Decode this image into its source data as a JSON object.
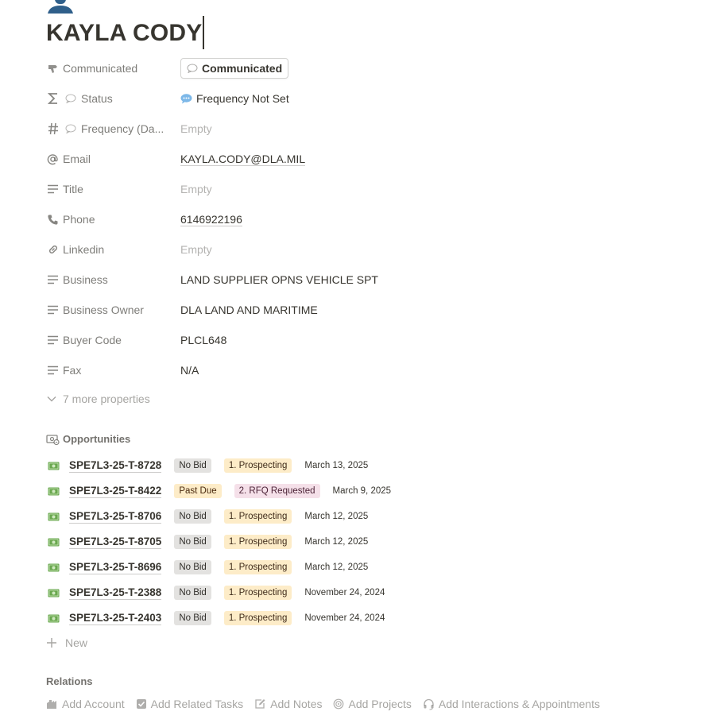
{
  "page": {
    "title": "KAYLA CODY"
  },
  "properties": [
    {
      "label": "Communicated",
      "value": "Communicated",
      "icon": "hand-pointer-icon",
      "type": "button"
    },
    {
      "label": "Status",
      "value": "Frequency Not Set",
      "icon": "formula-sigma-icon",
      "type": "status"
    },
    {
      "label": "Frequency (Da...",
      "value": "Empty",
      "icon": "number-hash-icon",
      "type": "empty"
    },
    {
      "label": "Email",
      "value": "KAYLA.CODY@DLA.MIL",
      "icon": "at-sign-icon",
      "type": "link"
    },
    {
      "label": "Title",
      "value": "Empty",
      "icon": "text-lines-icon",
      "type": "empty"
    },
    {
      "label": "Phone",
      "value": "6146922196",
      "icon": "phone-icon",
      "type": "link"
    },
    {
      "label": "Linkedin",
      "value": "Empty",
      "icon": "link-chain-icon",
      "type": "empty"
    },
    {
      "label": "Business",
      "value": "LAND SUPPLIER OPNS VEHICLE SPT",
      "icon": "text-lines-icon",
      "type": "text"
    },
    {
      "label": "Business Owner",
      "value": "DLA LAND AND MARITIME",
      "icon": "text-lines-icon",
      "type": "text"
    },
    {
      "label": "Buyer Code",
      "value": "PLCL648",
      "icon": "text-lines-icon",
      "type": "text"
    },
    {
      "label": "Fax",
      "value": "N/A",
      "icon": "text-lines-icon",
      "type": "text"
    }
  ],
  "more_properties": "7 more properties",
  "opportunities": {
    "heading": "Opportunities",
    "rows": [
      {
        "name": "SPE7L3-25-T-8728",
        "bid": "No Bid",
        "stage": "1. Prospecting",
        "date": "March 13, 2025"
      },
      {
        "name": "SPE7L3-25-T-8422",
        "bid": "Past Due",
        "stage": "2. RFQ Requested",
        "date": "March 9, 2025"
      },
      {
        "name": "SPE7L3-25-T-8706",
        "bid": "No Bid",
        "stage": "1. Prospecting",
        "date": "March 12, 2025"
      },
      {
        "name": "SPE7L3-25-T-8705",
        "bid": "No Bid",
        "stage": "1. Prospecting",
        "date": "March 12, 2025"
      },
      {
        "name": "SPE7L3-25-T-8696",
        "bid": "No Bid",
        "stage": "1. Prospecting",
        "date": "March 12, 2025"
      },
      {
        "name": "SPE7L3-25-T-2388",
        "bid": "No Bid",
        "stage": "1. Prospecting",
        "date": "November 24, 2024"
      },
      {
        "name": "SPE7L3-25-T-2403",
        "bid": "No Bid",
        "stage": "1. Prospecting",
        "date": "November 24, 2024"
      }
    ],
    "new_label": "New"
  },
  "relations": {
    "heading": "Relations",
    "items": [
      {
        "label": "Add Account",
        "icon": "building-icon"
      },
      {
        "label": "Add Related Tasks",
        "icon": "checkbox-icon"
      },
      {
        "label": "Add Notes",
        "icon": "edit-note-icon"
      },
      {
        "label": "Add Projects",
        "icon": "target-icon"
      },
      {
        "label": "Add Interactions & Appointments",
        "icon": "headset-icon"
      }
    ]
  },
  "colors": {
    "text": "#37352f",
    "tag_gray": "#e3e2e0",
    "tag_yellow": "#fdecc8",
    "tag_pink": "#f5e0e9",
    "money_green": "#6aa84f",
    "avatar_blue": "#2f5f8a"
  }
}
